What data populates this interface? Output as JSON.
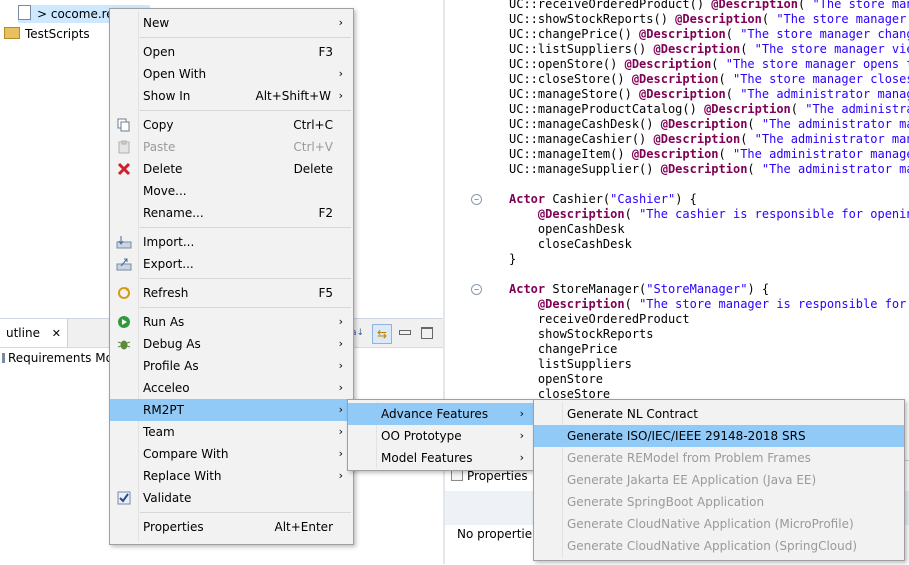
{
  "explorer": {
    "rows": [
      {
        "label": "> cocome.re...",
        "icon": "file-icon"
      },
      {
        "label": "TestScripts",
        "icon": "folder-icon"
      }
    ]
  },
  "outline": {
    "tab_label": "utline",
    "close_glyph": "✕",
    "content": "Requirements Mo"
  },
  "editor": {
    "lines": [
      "UC::receiveOrderedProduct() @Description( \"The store mana",
      "UC::showStockReports() @Description( \"The store manager v",
      "UC::changePrice() @Description( \"The store manager change",
      "UC::listSuppliers() @Description( \"The store manager view",
      "UC::openStore() @Description( \"The store manager opens th",
      "UC::closeStore() @Description( \"The store manager closes",
      "UC::manageStore() @Description( \"The administrator manage",
      "UC::manageProductCatalog() @Description( \"The administrat",
      "UC::manageCashDesk() @Description( \"The administrator man",
      "UC::manageCashier() @Description( \"The administrator man",
      "UC::manageItem() @Description( \"The administrator manages",
      "UC::manageSupplier() @Description( \"The administrator man",
      "",
      "Actor Cashier(\"Cashier\") {",
      "    @Description( \"The cashier is responsible for opening",
      "    openCashDesk",
      "    closeCashDesk",
      "}",
      "",
      "Actor StoreManager(\"StoreManager\") {",
      "    @Description( \"The store manager is responsible for p",
      "    receiveOrderedProduct",
      "    showStockReports",
      "    changePrice",
      "    listSuppliers",
      "    openStore",
      "    closeStore"
    ]
  },
  "properties": {
    "tab_label": "Properties",
    "content": "No propertie"
  },
  "context_menu": {
    "items": [
      {
        "label": "New",
        "submenu": true
      },
      {
        "sep": true
      },
      {
        "label": "Open",
        "shortcut": "F3"
      },
      {
        "label": "Open With",
        "submenu": true
      },
      {
        "label": "Show In",
        "shortcut": "Alt+Shift+W",
        "submenu": true
      },
      {
        "sep": true
      },
      {
        "label": "Copy",
        "shortcut": "Ctrl+C",
        "icon": "copy-icon"
      },
      {
        "label": "Paste",
        "shortcut": "Ctrl+V",
        "icon": "paste-icon",
        "disabled": true
      },
      {
        "label": "Delete",
        "shortcut": "Delete",
        "icon": "delete-icon"
      },
      {
        "label": "Move..."
      },
      {
        "label": "Rename...",
        "shortcut": "F2"
      },
      {
        "sep": true
      },
      {
        "label": "Import...",
        "icon": "import-icon"
      },
      {
        "label": "Export...",
        "icon": "export-icon"
      },
      {
        "sep": true
      },
      {
        "label": "Refresh",
        "shortcut": "F5",
        "icon": "refresh-icon"
      },
      {
        "sep": true
      },
      {
        "label": "Run As",
        "submenu": true,
        "icon": "run-icon"
      },
      {
        "label": "Debug As",
        "submenu": true,
        "icon": "debug-icon"
      },
      {
        "label": "Profile As",
        "submenu": true
      },
      {
        "label": "Acceleo",
        "submenu": true
      },
      {
        "label": "RM2PT",
        "submenu": true,
        "highlighted": true
      },
      {
        "label": "Team",
        "submenu": true
      },
      {
        "label": "Compare With",
        "submenu": true
      },
      {
        "label": "Replace With",
        "submenu": true
      },
      {
        "label": "Validate",
        "icon": "checkbox-icon"
      },
      {
        "sep": true
      },
      {
        "label": "Properties",
        "shortcut": "Alt+Enter"
      }
    ]
  },
  "rm2pt_menu": {
    "items": [
      {
        "label": "Advance Features",
        "submenu": true,
        "highlighted": true
      },
      {
        "label": "OO Prototype",
        "submenu": true
      },
      {
        "label": "Model Features",
        "submenu": true
      }
    ]
  },
  "advance_menu": {
    "items": [
      {
        "label": "Generate NL Contract"
      },
      {
        "label": "Generate ISO/IEC/IEEE 29148-2018 SRS",
        "highlighted": true
      },
      {
        "label": "Generate REModel from Problem Frames",
        "disabled": true
      },
      {
        "label": "Generate Jakarta EE Application (Java EE)",
        "disabled": true
      },
      {
        "label": "Generate SpringBoot Application",
        "disabled": true
      },
      {
        "label": "Generate CloudNative Application (MicroProfile)",
        "disabled": true
      },
      {
        "label": "Generate CloudNative Application (SpringCloud)",
        "disabled": true
      }
    ]
  },
  "glyphs": {
    "submenu_arrow": "›"
  },
  "colors": {
    "highlight": "#91c9f7",
    "menu_bg": "#f2f2f2",
    "keyword": "#7f0055",
    "string": "#2a00ff"
  }
}
